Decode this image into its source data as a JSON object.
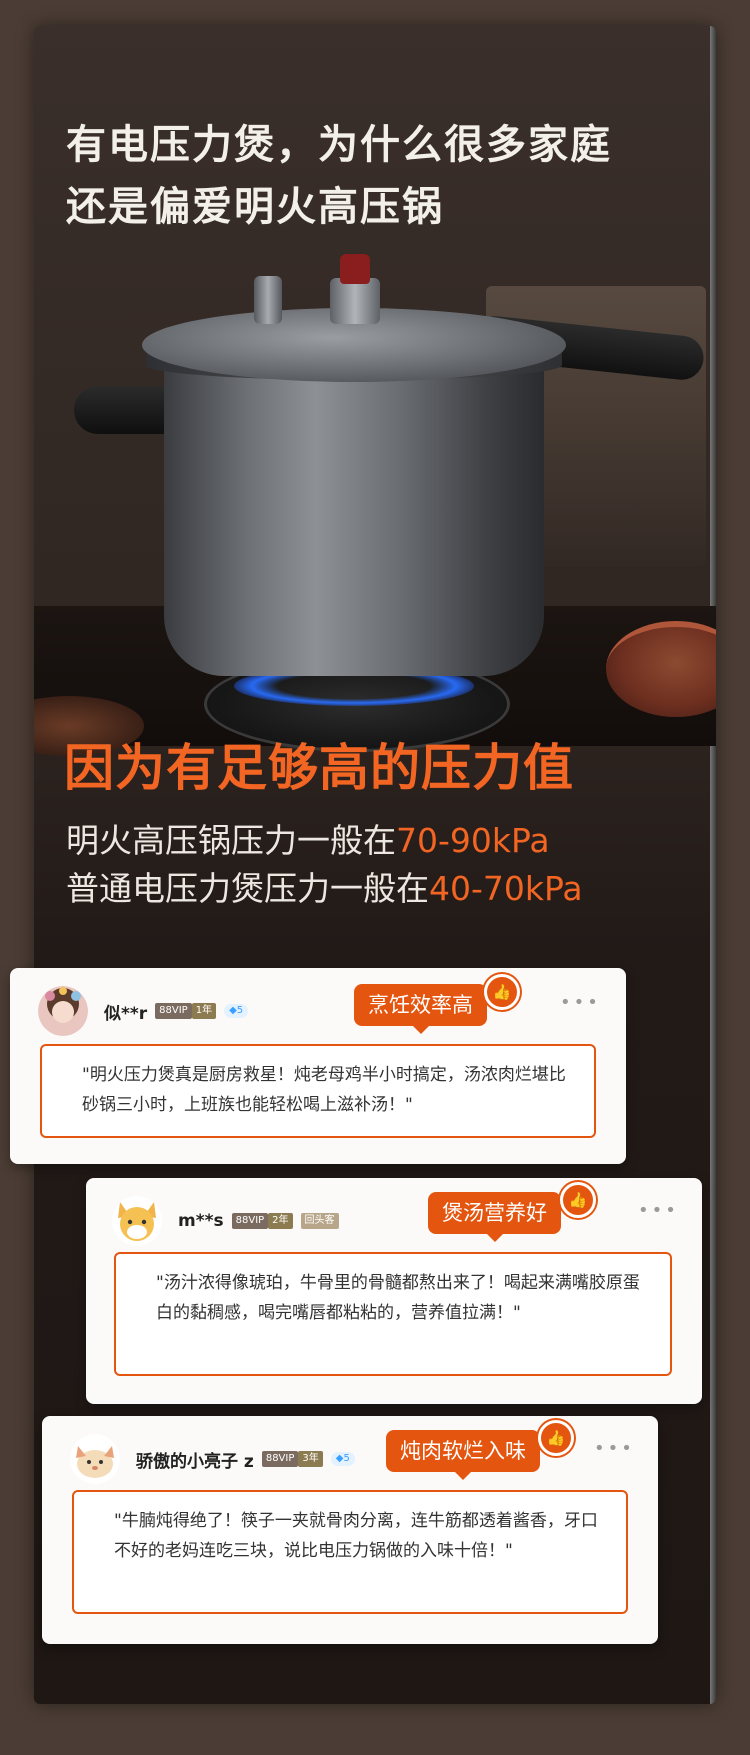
{
  "headline": {
    "line1": "有电压力煲，为什么很多家庭",
    "line2": "还是偏爱明火高压锅"
  },
  "highlight": "因为有足够高的压力值",
  "specs": [
    {
      "label": "明火高压锅压力一般在",
      "value": "70-90kPa"
    },
    {
      "label": "普通电压力煲压力一般在",
      "value": "40-70kPa"
    }
  ],
  "reviews": [
    {
      "name": "似**r",
      "vip_badge": "88VIP",
      "years_badge": "1年",
      "diamond_level": "5",
      "tag": "烹饪效率高",
      "text": "\"明火压力煲真是厨房救星！炖老母鸡半小时搞定，汤浓肉烂堪比砂锅三小时，上班族也能轻松喝上滋补汤！\""
    },
    {
      "name": "m**s",
      "vip_badge": "88VIP",
      "years_badge": "2年",
      "extra_badge": "回头客",
      "tag": "煲汤营养好",
      "text": "\"汤汁浓得像琥珀，牛骨里的骨髓都熬出来了！喝起来满嘴胶原蛋白的黏稠感，喝完嘴唇都粘粘的，营养值拉满！\""
    },
    {
      "name": "骄傲的小亮子 z",
      "vip_badge": "88VIP",
      "years_badge": "3年",
      "diamond_level": "5",
      "tag": "炖肉软烂入味",
      "text": "\"牛腩炖得绝了！筷子一夹就骨肉分离，连牛筋都透着酱香，牙口不好的老妈连吃三块，说比电压力锅做的入味十倍！\""
    }
  ],
  "icons": {
    "thumb": "thumbs-up-icon",
    "more": "more-dots-icon",
    "diamond": "diamond-icon"
  },
  "colors": {
    "accent": "#e4560f",
    "highlight": "#f26522"
  }
}
